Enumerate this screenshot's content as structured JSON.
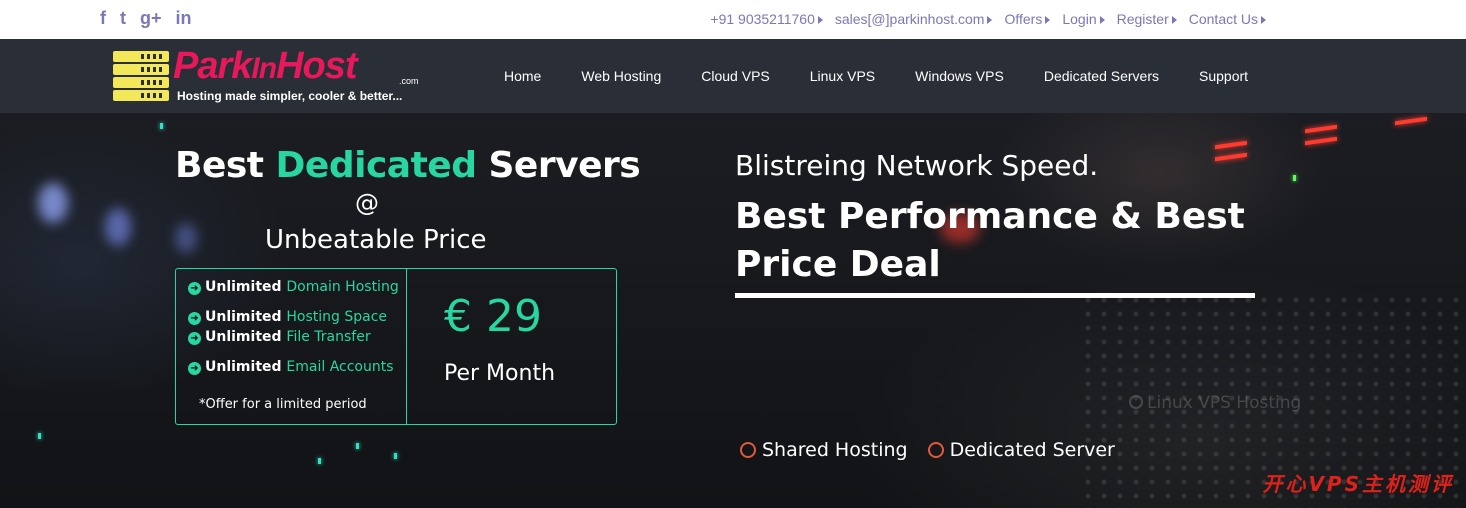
{
  "social": {
    "facebook": "f",
    "twitter": "t",
    "googleplus": "g+",
    "linkedin": "in"
  },
  "toplinks": {
    "phone": "+91 9035211760",
    "email": "sales[@]parkinhost.com",
    "offers": "Offers",
    "login": "Login",
    "register": "Register",
    "contact": "Contact Us"
  },
  "logo": {
    "name_park": "Park",
    "name_in": "In",
    "name_host": "Host",
    "dotcom": ".com",
    "tagline": "Hosting made simpler, cooler & better..."
  },
  "nav": {
    "items": [
      "Web Hosting",
      "Cloud VPS",
      "Linux VPS",
      "Windows VPS",
      "Dedicated Servers",
      "Support"
    ],
    "home": "Home"
  },
  "hero": {
    "title_pre": "Best ",
    "title_accent": "Dedicated",
    "title_post": " Servers",
    "at": "@",
    "subtitle": "Unbeatable Price",
    "features": [
      {
        "bold": "Unlimited ",
        "hl": "Domain Hosting"
      },
      {
        "bold": "Unlimited ",
        "hl": "Hosting Space"
      },
      {
        "bold": "Unlimited ",
        "hl": "File Transfer"
      },
      {
        "bold": "Unlimited ",
        "hl": "Email Accounts"
      }
    ],
    "note": "*Offer for a limited period",
    "price": "€ 29",
    "period": "Per Month",
    "right_line1": "Blistreing Network Speed.",
    "right_line2": "Best Performance & Best Price Deal",
    "slider_dim": "Linux VPS Hosting",
    "slider_tabs": [
      "Shared Hosting",
      "Dedicated Server"
    ],
    "watermark": "开心VPS主机测评"
  },
  "colors": {
    "accent_green": "#27d6a0",
    "brand_pink": "#e8185a",
    "nav_bg": "#2a2e37",
    "link_purple": "#7b78b8",
    "ring_orange": "#e05a3a"
  }
}
